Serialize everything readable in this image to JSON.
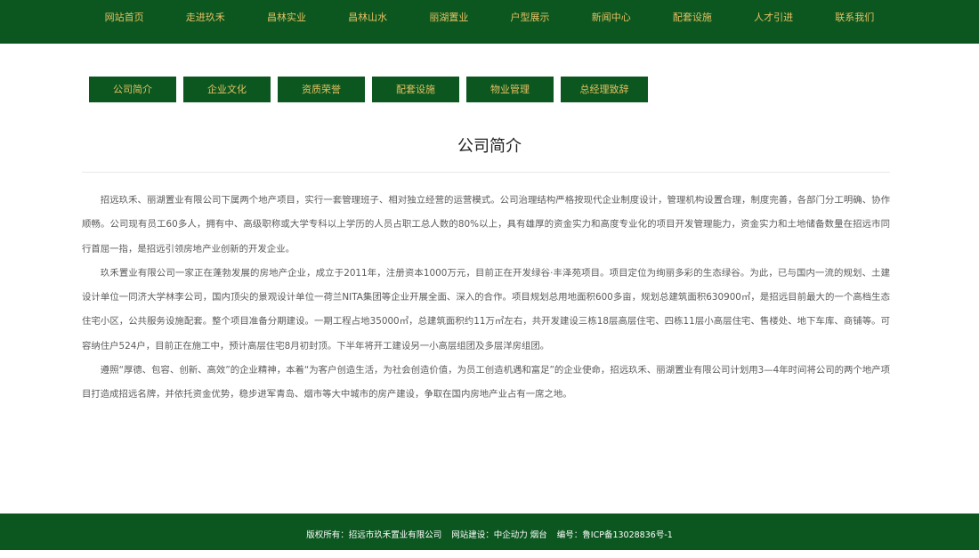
{
  "top_nav": {
    "items": [
      {
        "label": "网站首页"
      },
      {
        "label": "走进玖禾"
      },
      {
        "label": "昌林实业"
      },
      {
        "label": "昌林山水"
      },
      {
        "label": "丽湖置业"
      },
      {
        "label": "户型展示"
      },
      {
        "label": "新闻中心"
      },
      {
        "label": "配套设施"
      },
      {
        "label": "人才引进"
      },
      {
        "label": "联系我们"
      }
    ]
  },
  "sub_nav": {
    "items": [
      {
        "label": "公司简介"
      },
      {
        "label": "企业文化"
      },
      {
        "label": "资质荣誉"
      },
      {
        "label": "配套设施"
      },
      {
        "label": "物业管理"
      },
      {
        "label": "总经理致辞"
      }
    ]
  },
  "page": {
    "title": "公司简介",
    "paragraphs": [
      "招远玖禾、丽湖置业有限公司下属两个地产项目，实行一套管理班子、相对独立经营的运营模式。公司治理结构严格按现代企业制度设计，管理机构设置合理，制度完善，各部门分工明确、协作顺畅。公司现有员工60多人，拥有中、高级职称或大学专科以上学历的人员占职工总人数的80%以上，具有雄厚的资金实力和高度专业化的项目开发管理能力，资金实力和土地储备数量在招远市同行首屈一指，是招远引领房地产业创新的开发企业。",
      "玖禾置业有限公司一家正在蓬勃发展的房地产企业，成立于2011年，注册资本1000万元，目前正在开发绿谷·丰泽苑项目。项目定位为绚丽多彩的生态绿谷。为此，已与国内一流的规划、土建设计单位一同济大学林李公司，国内顶尖的景观设计单位一荷兰NITA集团等企业开展全面、深入的合作。项目规划总用地面积600多亩，规划总建筑面积630900㎡，是招远目前最大的一个高档生态住宅小区，公共服务设施配套。整个项目准备分期建设。一期工程占地35000㎡，总建筑面积约11万㎡左右，共开发建设三栋18层高层住宅、四栋11层小高层住宅、售楼处、地下车库、商铺等。可容纳住户524户，目前正在施工中，预计高层住宅8月初封顶。下半年将开工建设另一小高层组团及多层洋房组团。",
      "遵照“厚德、包容、创新、高效”的企业精神，本着“为客户创造生活，为社会创造价值，为员工创造机遇和富足”的企业使命，招远玖禾、丽湖置业有限公司计划用3—4年时间将公司的两个地产项目打造成招远名牌，并依托资金优势，稳步进军青岛、烟市等大中城市的房产建设，争取在国内房地产业占有一席之地。"
    ]
  },
  "footer": {
    "copyright": "版权所有：招远市玖禾置业有限公司",
    "builder": "网站建设：中企动力  烟台",
    "icp": "编号：鲁ICP备13028836号-1"
  },
  "colors": {
    "brand_green": "#0b571f",
    "nav_text_gold": "#e4c063",
    "body_text": "#5b5b5b"
  }
}
